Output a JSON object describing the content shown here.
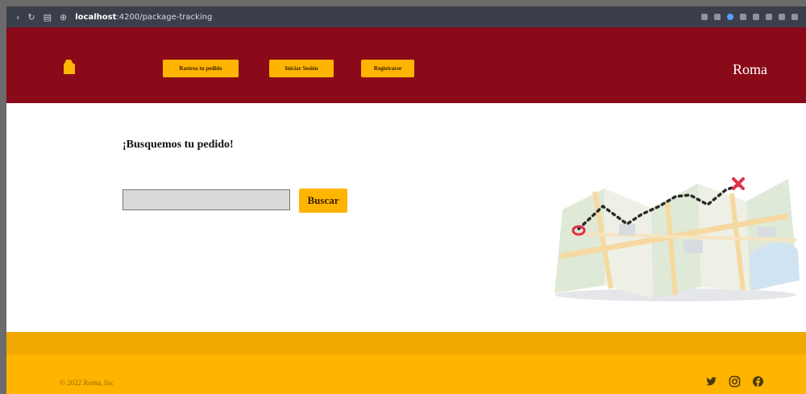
{
  "browser": {
    "url_host": "localhost",
    "url_path": ":4200/package-tracking"
  },
  "header": {
    "nav": [
      {
        "label": "Rastrea tu pedido"
      },
      {
        "label": "Iniciar Sesión"
      },
      {
        "label": "Registrarse"
      }
    ],
    "brand": "Roma"
  },
  "main": {
    "title": "¡Busquemos tu pedido!",
    "search": {
      "value": "",
      "placeholder": "",
      "button_label": "Buscar"
    }
  },
  "footer": {
    "copyright": "© 2022 Roma, Inc",
    "social_icons": [
      "twitter-icon",
      "instagram-icon",
      "facebook-icon"
    ]
  },
  "colors": {
    "header_bg": "#8a0a1a",
    "accent": "#ffb400",
    "footer_band": "#f0a800"
  }
}
